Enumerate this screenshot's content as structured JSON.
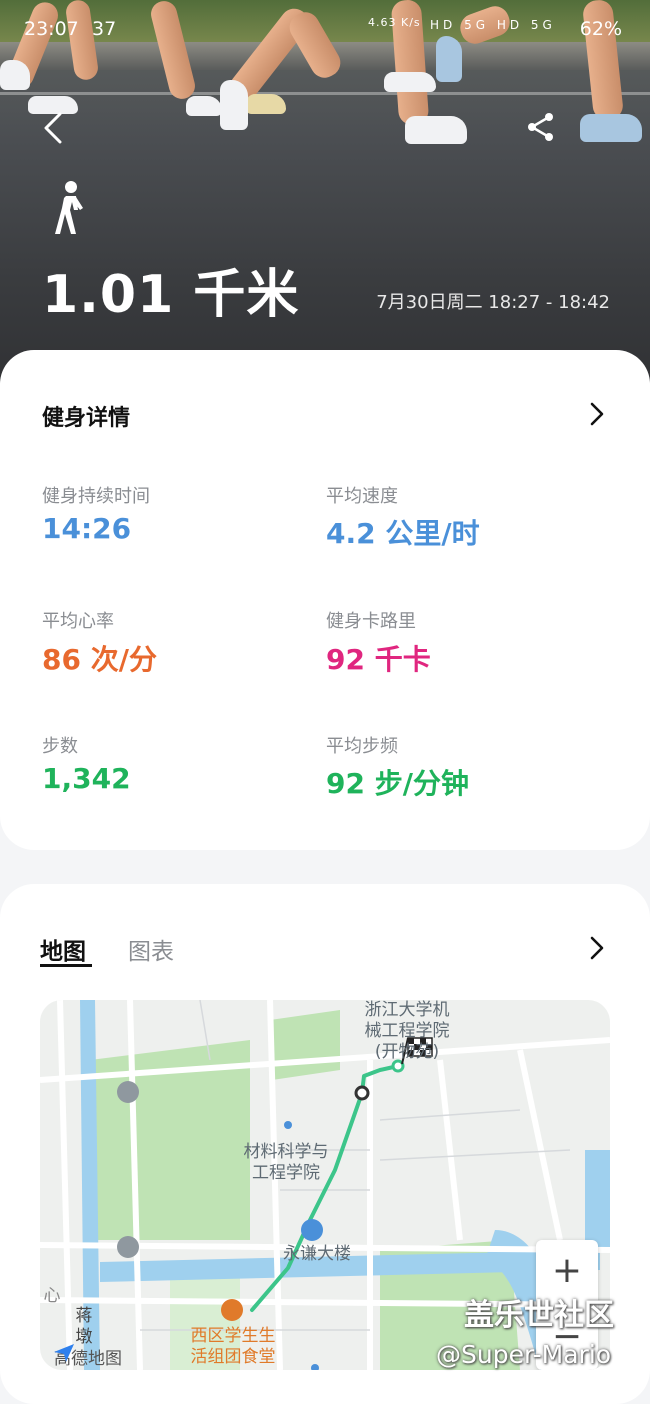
{
  "status_bar": {
    "time": "23:07",
    "extra": "37",
    "net_speed": "4.63 K/s",
    "signal_text": "HD 5G HD 5G",
    "battery": "62%"
  },
  "hero": {
    "activity_icon": "walking-person-icon",
    "distance": "1.01 千米",
    "time_range": "7月30日周二 18:27 - 18:42"
  },
  "details": {
    "title": "健身详情",
    "stats": [
      {
        "label": "健身持续时间",
        "value": "14:26",
        "color": "#4a90d9"
      },
      {
        "label": "平均速度",
        "value": "4.2 公里/时",
        "color": "#4a90d9"
      },
      {
        "label": "平均心率",
        "value": "86 次/分",
        "color": "#e8692e"
      },
      {
        "label": "健身卡路里",
        "value": "92 千卡",
        "color": "#e0267f"
      },
      {
        "label": "步数",
        "value": "1,342",
        "color": "#1fb35b"
      },
      {
        "label": "平均步频",
        "value": "92 步/分钟",
        "color": "#1fb35b"
      }
    ]
  },
  "map_section": {
    "tabs": [
      {
        "label": "地图",
        "active": true
      },
      {
        "label": "图表",
        "active": false
      }
    ],
    "labels": {
      "college_top": "浙江大学机\n械工程学院\n(开物苑)",
      "materials": "材料科学与\n工程学院",
      "building": "永谦大楼",
      "canteen": "西区学生生\n活组团食堂",
      "left_side": "蒋\n墩",
      "left_side2": "心"
    },
    "provider": "高德地图",
    "zoom_in": "+",
    "zoom_out": "−"
  },
  "watermark": {
    "site": "盖乐世社区",
    "user": "@Super-Mario"
  },
  "colors": {
    "route": "#3cc58a",
    "blue_stat": "#4a90d9",
    "orange_stat": "#e8692e",
    "pink_stat": "#e0267f",
    "green_stat": "#1fb35b"
  }
}
